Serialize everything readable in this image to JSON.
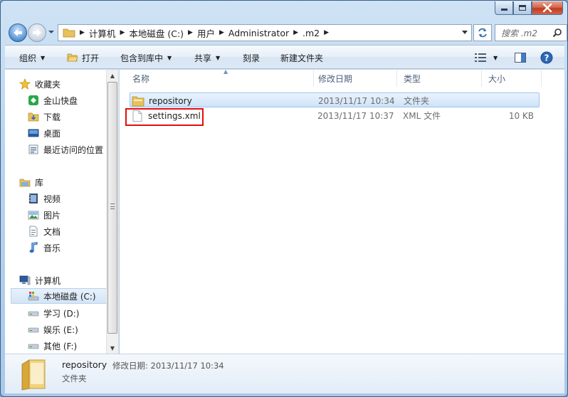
{
  "window": {
    "caption_buttons": [
      "minimize",
      "maximize",
      "close"
    ]
  },
  "address": {
    "breadcrumbs": [
      "计算机",
      "本地磁盘 (C:)",
      "用户",
      "Administrator",
      ".m2"
    ]
  },
  "search": {
    "placeholder": "搜索 .m2"
  },
  "toolbar": {
    "organize": "组织",
    "open": "打开",
    "include_in_library": "包含到库中",
    "share": "共享",
    "burn": "刻录",
    "new_folder": "新建文件夹"
  },
  "sidebar": {
    "favorites": {
      "label": "收藏夹",
      "items": [
        {
          "label": "金山快盘",
          "icon": "kuaipan-icon"
        },
        {
          "label": "下载",
          "icon": "download-folder-icon"
        },
        {
          "label": "桌面",
          "icon": "desktop-icon"
        },
        {
          "label": "最近访问的位置",
          "icon": "recent-places-icon"
        }
      ]
    },
    "libraries": {
      "label": "库",
      "items": [
        {
          "label": "视频",
          "icon": "video-icon"
        },
        {
          "label": "图片",
          "icon": "pictures-icon"
        },
        {
          "label": "文档",
          "icon": "documents-icon"
        },
        {
          "label": "音乐",
          "icon": "music-icon"
        }
      ]
    },
    "computer": {
      "label": "计算机",
      "items": [
        {
          "label": "本地磁盘 (C:)",
          "icon": "drive-c-icon",
          "selected": true
        },
        {
          "label": "学习 (D:)",
          "icon": "drive-icon"
        },
        {
          "label": "娱乐 (E:)",
          "icon": "drive-icon"
        },
        {
          "label": "其他 (F:)",
          "icon": "drive-icon"
        }
      ]
    }
  },
  "file_list": {
    "columns": [
      "名称",
      "修改日期",
      "类型",
      "大小"
    ],
    "rows": [
      {
        "name": "repository",
        "modified": "2013/11/17 10:34",
        "type": "文件夹",
        "size": "",
        "icon": "folder-icon",
        "selected": true
      },
      {
        "name": "settings.xml",
        "modified": "2013/11/17 10:37",
        "type": "XML 文件",
        "size": "10 KB",
        "icon": "xml-file-icon",
        "selected": false
      }
    ]
  },
  "details": {
    "name": "repository",
    "meta": "修改日期: 2013/11/17 10:34",
    "type": "文件夹"
  },
  "colors": {
    "selection_border": "#9ec4ea",
    "annotation_red": "#e01010",
    "header_text": "#4c607a"
  }
}
